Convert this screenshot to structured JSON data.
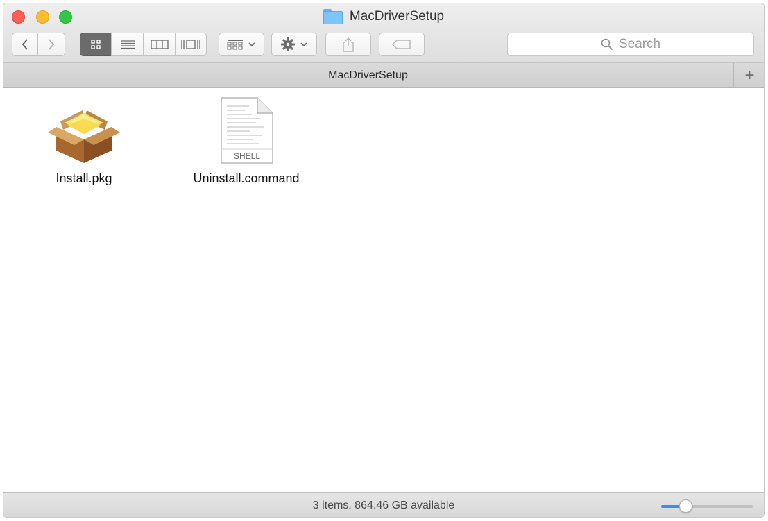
{
  "window": {
    "title": "MacDriverSetup"
  },
  "toolbar": {
    "back_icon": "chevron-left-icon",
    "forward_icon": "chevron-right-icon",
    "view_modes": [
      "icon-view",
      "list-view",
      "column-view",
      "cover-flow-view"
    ],
    "active_view": "icon-view",
    "arrange_icon": "arrange-grid-icon",
    "action_icon": "gear-icon",
    "share_icon": "share-icon",
    "tag_icon": "tag-icon"
  },
  "search": {
    "placeholder": "Search"
  },
  "tabbar": {
    "active_tab": "MacDriverSetup",
    "add_label": "+"
  },
  "files": [
    {
      "name": "Install.pkg",
      "icon": "package-icon"
    },
    {
      "name": "Uninstall.command",
      "icon": "shell-script-icon",
      "badge": "SHELL"
    }
  ],
  "statusbar": {
    "text": "3 items, 864.46 GB available",
    "icon_size_level": 0.27
  },
  "colors": {
    "close": "#fc5f57",
    "minimize": "#fdbc2e",
    "zoom": "#33c748",
    "accent": "#3b8ef7",
    "folder": "#7dc5f9"
  }
}
